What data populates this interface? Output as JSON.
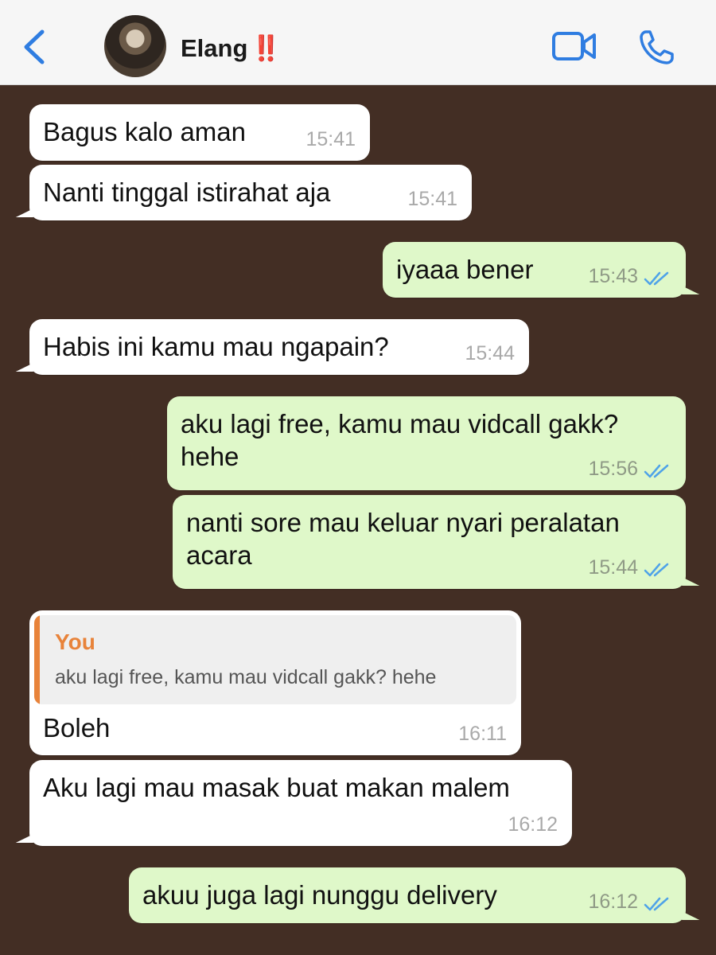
{
  "header": {
    "contact_name": "Elang",
    "name_mark": "‼️",
    "back_icon": "chevron-left-icon",
    "video_icon": "video-camera-icon",
    "call_icon": "phone-icon"
  },
  "colors": {
    "accent": "#2f7de1",
    "chat_background": "#432e24",
    "incoming_bubble": "#ffffff",
    "outgoing_bubble": "#dff8c9",
    "quote_accent": "#e8833a",
    "read_ticks": "#4fa3e8"
  },
  "messages": [
    {
      "direction": "in",
      "text": "Bagus kalo aman",
      "time": "15:41"
    },
    {
      "direction": "in",
      "text": "Nanti tinggal istirahat aja",
      "time": "15:41"
    },
    {
      "direction": "out",
      "text": "iyaaa bener",
      "time": "15:43",
      "status": "read"
    },
    {
      "direction": "in",
      "text": "Habis ini kamu mau ngapain?",
      "time": "15:44"
    },
    {
      "direction": "out",
      "text_line1": "aku lagi free, kamu mau vidcall gakk?",
      "text_line2": "hehe",
      "time": "15:56",
      "status": "read"
    },
    {
      "direction": "out",
      "text_line1": "nanti sore mau keluar nyari peralatan",
      "text_line2": "acara",
      "time": "15:44",
      "status": "read"
    },
    {
      "direction": "in",
      "quote_author": "You",
      "quote_text": "aku lagi free, kamu mau vidcall gakk? hehe",
      "text": "Boleh",
      "time": "16:11"
    },
    {
      "direction": "in",
      "text": "Aku lagi mau masak buat makan malem",
      "time": "16:12"
    },
    {
      "direction": "out",
      "text": "akuu juga lagi nunggu delivery",
      "time": "16:12",
      "status": "read"
    }
  ]
}
